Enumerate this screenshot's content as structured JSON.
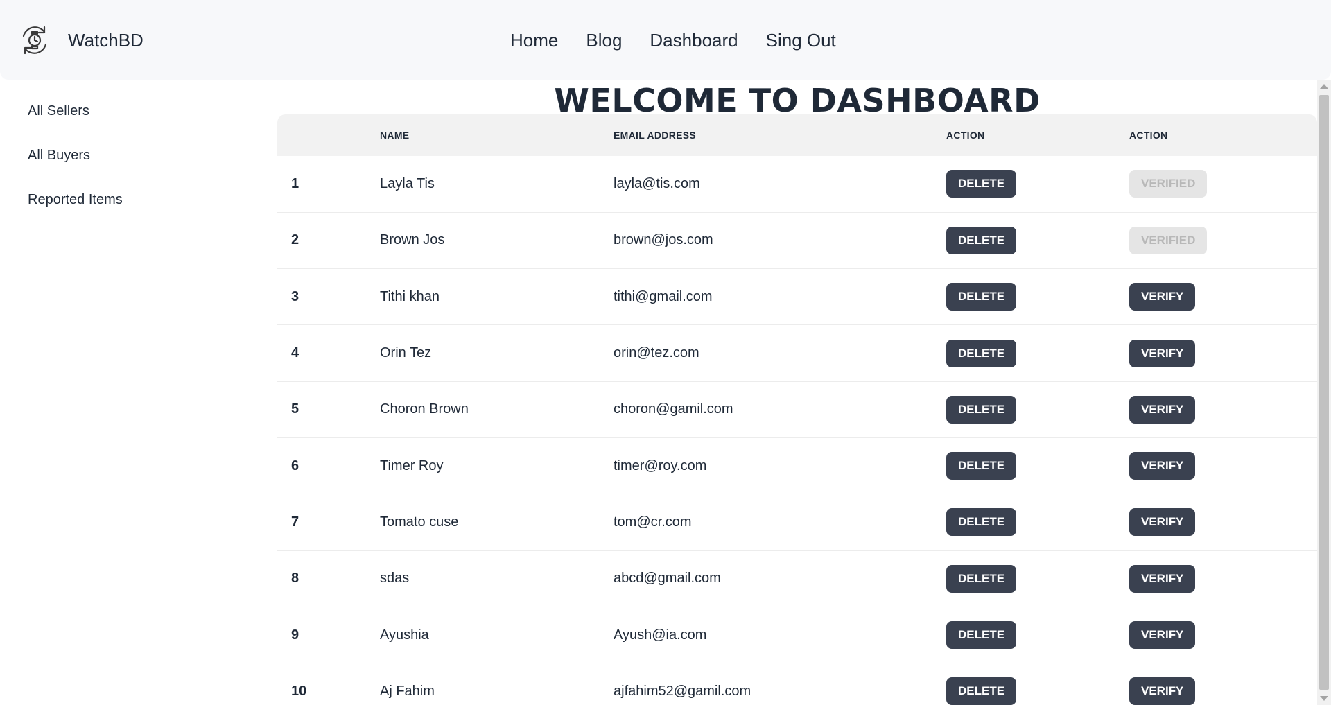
{
  "brand": {
    "name": "WatchBD",
    "logo_icon": "watch-refresh-icon"
  },
  "nav": {
    "links": [
      {
        "label": "Home"
      },
      {
        "label": "Blog"
      },
      {
        "label": "Dashboard"
      },
      {
        "label": "Sing Out"
      }
    ]
  },
  "sidebar": {
    "items": [
      {
        "label": "All Sellers"
      },
      {
        "label": "All Buyers"
      },
      {
        "label": "Reported Items"
      }
    ]
  },
  "main": {
    "title": "WELCOME TO DASHBOARD",
    "table": {
      "headers": [
        "",
        "NAME",
        "EMAIL ADDRESS",
        "ACTION",
        "ACTION"
      ],
      "rows": [
        {
          "index": "1",
          "name": "Layla Tis",
          "email": "layla@tis.com",
          "delete_label": "DELETE",
          "verify_label": "VERIFIED",
          "verified": true
        },
        {
          "index": "2",
          "name": "Brown Jos",
          "email": "brown@jos.com",
          "delete_label": "DELETE",
          "verify_label": "VERIFIED",
          "verified": true
        },
        {
          "index": "3",
          "name": "Tithi khan",
          "email": "tithi@gmail.com",
          "delete_label": "DELETE",
          "verify_label": "VERIFY",
          "verified": false
        },
        {
          "index": "4",
          "name": "Orin Tez",
          "email": "orin@tez.com",
          "delete_label": "DELETE",
          "verify_label": "VERIFY",
          "verified": false
        },
        {
          "index": "5",
          "name": "Choron Brown",
          "email": "choron@gamil.com",
          "delete_label": "DELETE",
          "verify_label": "VERIFY",
          "verified": false
        },
        {
          "index": "6",
          "name": "Timer Roy",
          "email": "timer@roy.com",
          "delete_label": "DELETE",
          "verify_label": "VERIFY",
          "verified": false
        },
        {
          "index": "7",
          "name": "Tomato cuse",
          "email": "tom@cr.com",
          "delete_label": "DELETE",
          "verify_label": "VERIFY",
          "verified": false
        },
        {
          "index": "8",
          "name": "sdas",
          "email": "abcd@gmail.com",
          "delete_label": "DELETE",
          "verify_label": "VERIFY",
          "verified": false
        },
        {
          "index": "9",
          "name": "Ayushia",
          "email": "Ayush@ia.com",
          "delete_label": "DELETE",
          "verify_label": "VERIFY",
          "verified": false
        },
        {
          "index": "10",
          "name": "Aj Fahim",
          "email": "ajfahim52@gamil.com",
          "delete_label": "DELETE",
          "verify_label": "VERIFY",
          "verified": false
        }
      ]
    }
  },
  "colors": {
    "navbar_bg": "#f7f8fa",
    "button_dark": "#3a4150",
    "button_disabled_bg": "#e5e5e5",
    "button_disabled_text": "#b8b8b8",
    "table_header_bg": "#f2f2f2"
  }
}
